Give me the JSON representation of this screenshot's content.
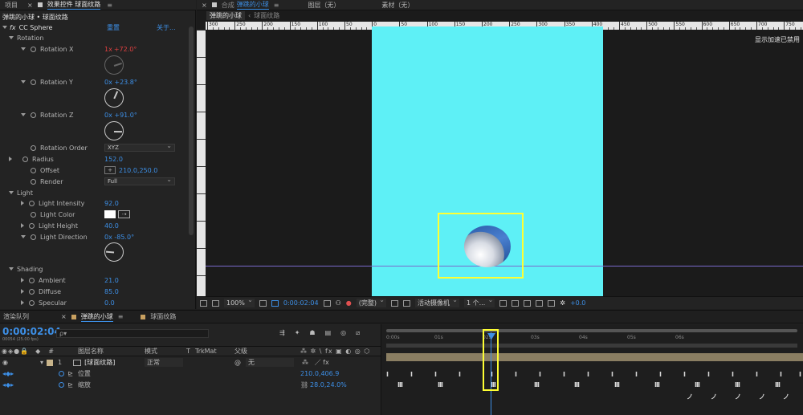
{
  "left_tabs": {
    "project": "项目",
    "effect_controls": "效果控件 球面纹路",
    "close_x": "×"
  },
  "effects": {
    "breadcrumb": "弹跳的小球 • 球面纹路",
    "effect_name": "CC Sphere",
    "reset": "重置",
    "about": "关于...",
    "rotation_group": "Rotation",
    "rotation_x_label": "Rotation X",
    "rotation_x_rev": "1x",
    "rotation_x_deg": "+72.0°",
    "rotation_x_deg_num": 72,
    "rotation_y_label": "Rotation Y",
    "rotation_y_value": "0x +23.8°",
    "rotation_y_deg_num": 23.8,
    "rotation_z_label": "Rotation Z",
    "rotation_z_value": "0x +91.0°",
    "rotation_z_deg_num": 91,
    "rotation_order_label": "Rotation Order",
    "rotation_order_value": "XYZ",
    "radius_label": "Radius",
    "radius_value": "152.0",
    "offset_label": "Offset",
    "offset_value": "210.0,250.0",
    "render_label": "Render",
    "render_value": "Full",
    "light_group": "Light",
    "light_intensity_label": "Light Intensity",
    "light_intensity_value": "92.0",
    "light_color_label": "Light Color",
    "light_height_label": "Light Height",
    "light_height_value": "40.0",
    "light_direction_label": "Light Direction",
    "light_direction_value": "0x -85.0°",
    "light_direction_deg_num": -85,
    "shading_group": "Shading",
    "ambient_label": "Ambient",
    "ambient_value": "21.0",
    "diffuse_label": "Diffuse",
    "diffuse_value": "85.0",
    "specular_label": "Specular",
    "specular_value": "0.0"
  },
  "viewer_tabs": {
    "composition": "合成",
    "composition_name": "弹跳的小球",
    "layer": "图层（无）",
    "footage": "素材（无）",
    "sub_tab_1": "弹跳的小球",
    "sub_tab_2": "球面纹路",
    "gpu_notice": "显示加速已禁用"
  },
  "ruler": {
    "top_ticks": [
      "300",
      "250",
      "200",
      "150",
      "100",
      "50",
      "0",
      "50",
      "100",
      "150",
      "200",
      "250",
      "300",
      "350",
      "400",
      "450",
      "500",
      "550",
      "600",
      "650",
      "700",
      "750"
    ]
  },
  "viewer_toolbar": {
    "zoom": "100%",
    "timecode": "0:00:02:04",
    "quality": "(完整)",
    "camera": "活动摄像机",
    "views": "1 个...",
    "exposure": "+0.0"
  },
  "timeline": {
    "render_queue_tab": "渲染队列",
    "comp_tab": "弹跳的小球",
    "texture_tab": "球面纹路",
    "timecode": "0:00:02:04",
    "frame_info": "00054 (25.00 fps)",
    "search_placeholder": "ρ▾",
    "col_layer_name": "图层名称",
    "col_mode": "模式",
    "col_t": "T",
    "col_trkmat": "TrkMat",
    "col_parent": "父级",
    "layer_index": "1",
    "layer_name": "[球面纹路]",
    "layer_mode": "正常",
    "layer_parent": "无",
    "prop_position": "位置",
    "prop_position_value": "210.0,406.9",
    "prop_scale": "缩放",
    "prop_scale_value": "28.0,24.0%",
    "time_ticks": [
      "0:00s",
      "01s",
      "02s",
      "03s",
      "04s",
      "05s",
      "06s"
    ]
  },
  "colors": {
    "accent": "#3d8fe6",
    "canvas": "#5ef0f6",
    "highlight": "#ffff33",
    "keyframe_red": "#e04040"
  }
}
